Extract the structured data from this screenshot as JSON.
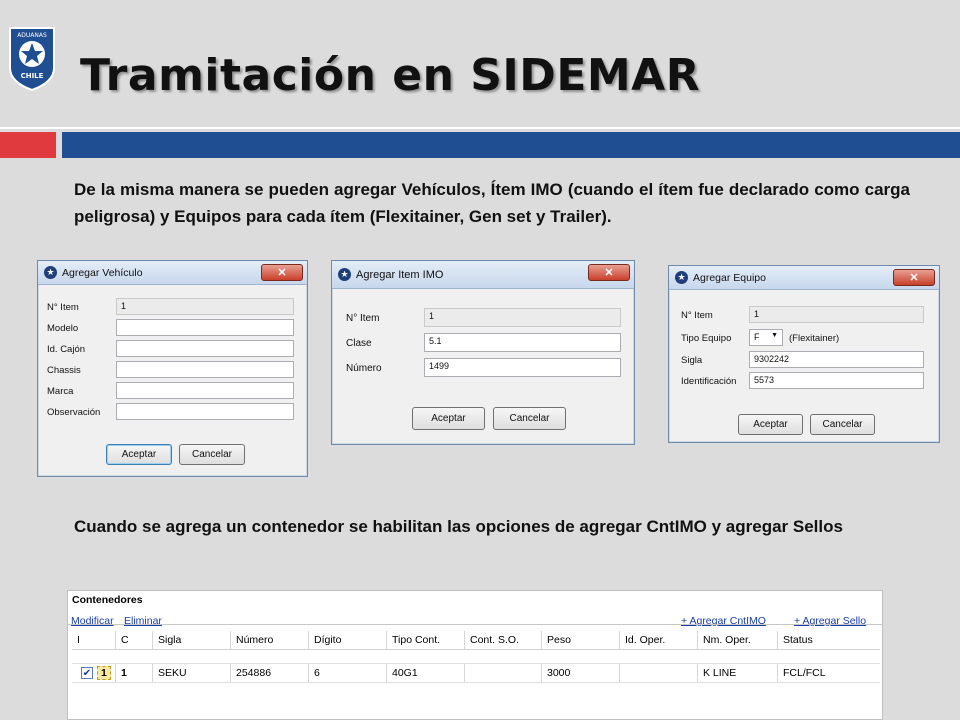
{
  "slide": {
    "title": "Tramitación en SIDEMAR",
    "paragraph1": "De la misma manera se pueden agregar Vehículos, Ítem IMO (cuando el ítem fue declarado como carga peligrosa) y Equipos para cada ítem (Flexitainer, Gen set y Trailer).",
    "paragraph2": "Cuando se agrega un contenedor se habilitan las opciones de agregar CntIMO y agregar Sellos",
    "logo_text_top": "ADUANAS",
    "logo_text_bottom": "CHILE"
  },
  "colors": {
    "accent_red": "#e03a3e",
    "accent_blue": "#1f4e93"
  },
  "dialog_vehiculo": {
    "title": "Agregar Vehículo",
    "close_label": "✕",
    "fields": [
      {
        "label": "N° Item",
        "value": "1"
      },
      {
        "label": "Modelo",
        "value": ""
      },
      {
        "label": "Id. Cajón",
        "value": ""
      },
      {
        "label": "Chassis",
        "value": ""
      },
      {
        "label": "Marca",
        "value": ""
      },
      {
        "label": "Observación",
        "value": ""
      }
    ],
    "accept_label": "Aceptar",
    "cancel_label": "Cancelar"
  },
  "dialog_imo": {
    "title": "Agregar Item IMO",
    "close_label": "✕",
    "fields": [
      {
        "label": "N° Item",
        "value": "1"
      },
      {
        "label": "Clase",
        "value": "5.1"
      },
      {
        "label": "Número",
        "value": "1499"
      }
    ],
    "accept_label": "Aceptar",
    "cancel_label": "Cancelar"
  },
  "dialog_equipo": {
    "title": "Agregar Equipo",
    "close_label": "✕",
    "fields": [
      {
        "label": "N° Item",
        "value": "1"
      },
      {
        "label": "Tipo Equipo",
        "value": "F",
        "note": "(Flexitainer)"
      },
      {
        "label": "Sigla",
        "value": "9302242"
      },
      {
        "label": "Identificación",
        "value": "5573"
      }
    ],
    "accept_label": "Aceptar",
    "cancel_label": "Cancelar"
  },
  "contenedores": {
    "title": "Contenedores",
    "modify_link": "Modificar",
    "delete_link": "Eliminar",
    "add_cntimo_link": "+ Agregar CntIMO",
    "add_sello_link": "+ Agregar Sello",
    "columns": [
      "I",
      "C",
      "Sigla",
      "Número",
      "Dígito",
      "Tipo Cont.",
      "Cont. S.O.",
      "Peso",
      "Id. Oper.",
      "Nm. Oper.",
      "Status"
    ],
    "rows": [
      [
        "",
        "1",
        "SEKU",
        "254886",
        "6",
        "40G1",
        "",
        "3000",
        "",
        "K LINE",
        "FCL/FCL"
      ]
    ]
  }
}
